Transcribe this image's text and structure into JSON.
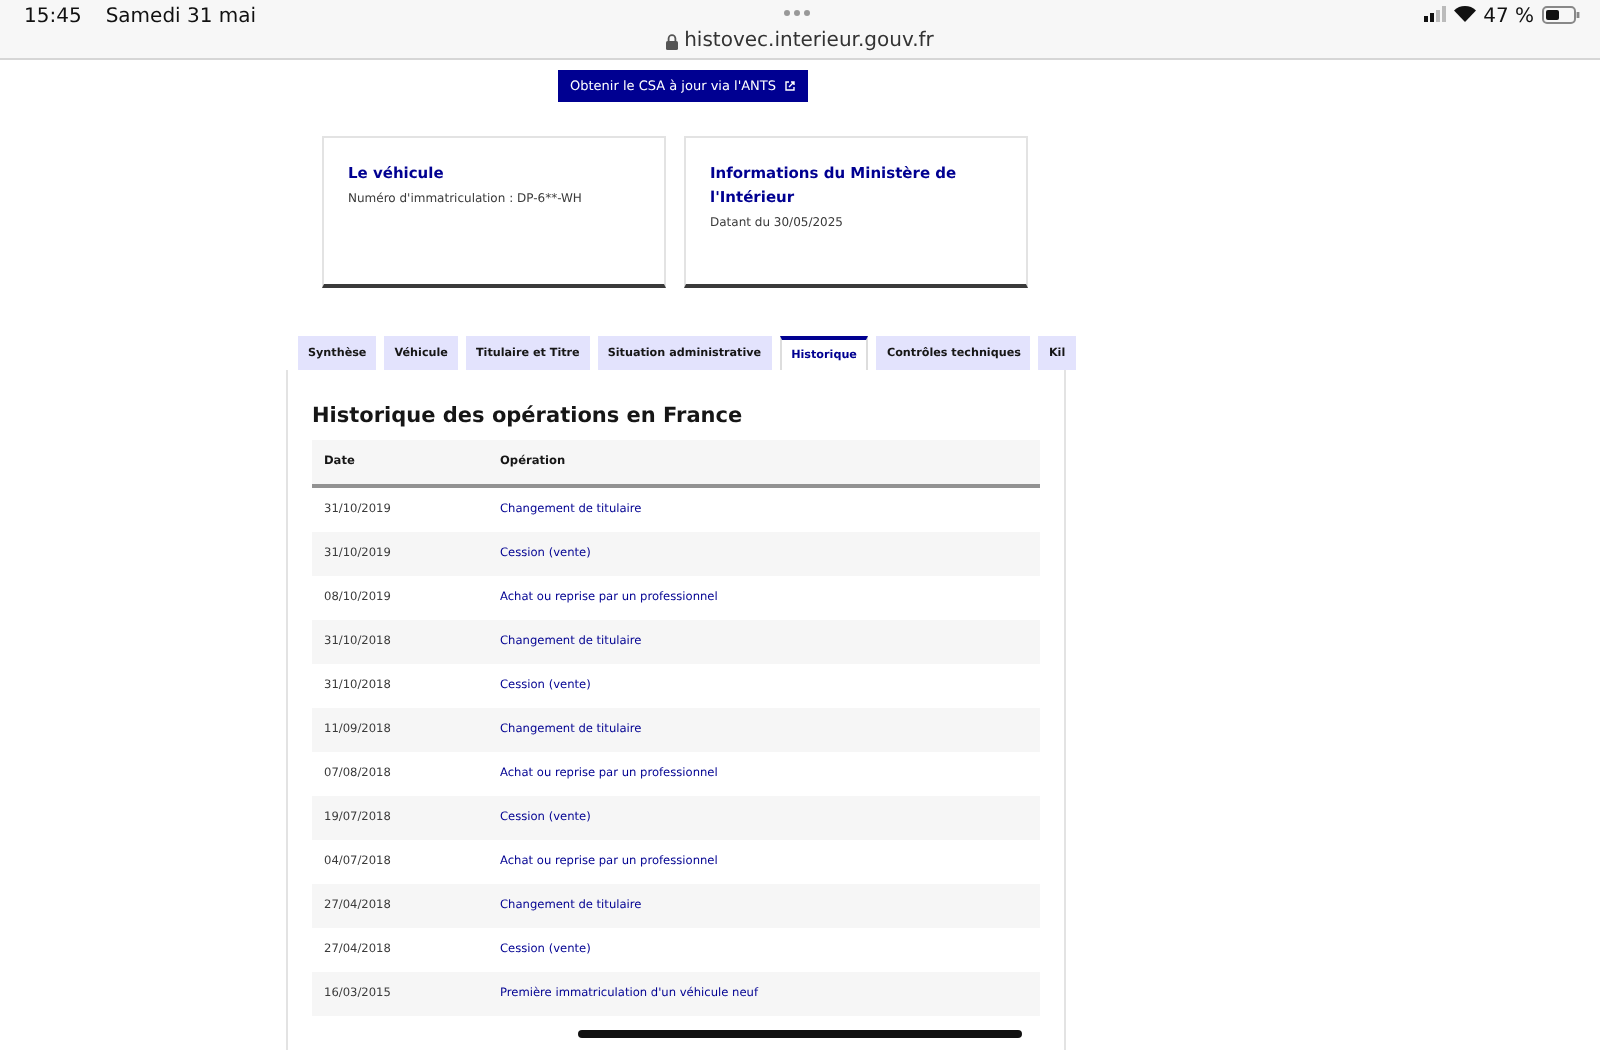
{
  "status_bar": {
    "time": "15:45",
    "date": "Samedi 31 mai",
    "url": "histovec.interieur.gouv.fr",
    "battery": "47 %"
  },
  "ants_button": {
    "label": "Obtenir le CSA à jour via l'ANTS"
  },
  "cards": [
    {
      "title": "Le véhicule",
      "text": "Numéro d'immatriculation : DP-6**-WH"
    },
    {
      "title": "Informations du Ministère de l'Intérieur",
      "text": "Datant du 30/05/2025"
    }
  ],
  "tabs": [
    {
      "label": "Synthèse",
      "selected": false
    },
    {
      "label": "Véhicule",
      "selected": false
    },
    {
      "label": "Titulaire et Titre",
      "selected": false
    },
    {
      "label": "Situation administrative",
      "selected": false
    },
    {
      "label": "Historique",
      "selected": true
    },
    {
      "label": "Contrôles techniques",
      "selected": false
    },
    {
      "label": "Kil",
      "selected": false
    }
  ],
  "section_title": "Historique des opérations en France",
  "table": {
    "columns": [
      "Date",
      "Opération"
    ],
    "rows": [
      [
        "31/10/2019",
        "Changement de titulaire"
      ],
      [
        "31/10/2019",
        "Cession (vente)"
      ],
      [
        "08/10/2019",
        "Achat ou reprise par un professionnel"
      ],
      [
        "31/10/2018",
        "Changement de titulaire"
      ],
      [
        "31/10/2018",
        "Cession (vente)"
      ],
      [
        "11/09/2018",
        "Changement de titulaire"
      ],
      [
        "07/08/2018",
        "Achat ou reprise par un professionnel"
      ],
      [
        "19/07/2018",
        "Cession (vente)"
      ],
      [
        "04/07/2018",
        "Achat ou reprise par un professionnel"
      ],
      [
        "27/04/2018",
        "Changement de titulaire"
      ],
      [
        "27/04/2018",
        "Cession (vente)"
      ],
      [
        "16/03/2015",
        "Première immatriculation d'un véhicule neuf"
      ]
    ]
  }
}
